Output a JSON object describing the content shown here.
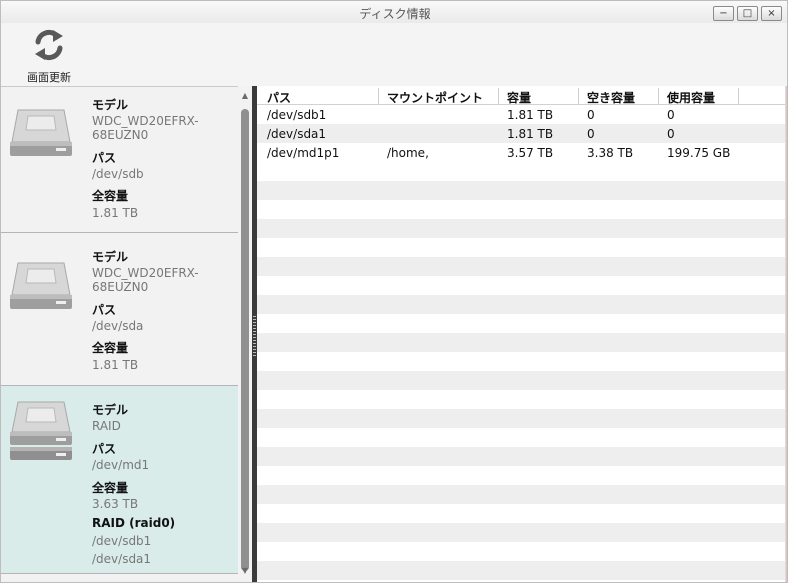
{
  "window": {
    "title": "ディスク情報",
    "buttons": {
      "minimize": "−",
      "maximize": "□",
      "close": "×"
    }
  },
  "toolbar": {
    "refresh_label": "画面更新",
    "refresh_icon": "refresh-icon"
  },
  "disks": [
    {
      "icon": "hard-drive-icon",
      "model_label": "モデル",
      "model_line1": "WDC_WD20EFRX-",
      "model_line2": "68EUZN0",
      "path_label": "パス",
      "path": "/dev/sdb",
      "capacity_label": "全容量",
      "capacity": "1.81 TB"
    },
    {
      "icon": "hard-drive-icon",
      "model_label": "モデル",
      "model_line1": "WDC_WD20EFRX-",
      "model_line2": "68EUZN0",
      "path_label": "パス",
      "path": "/dev/sda",
      "capacity_label": "全容量",
      "capacity": "1.81 TB"
    },
    {
      "icon": "raid-drive-icon",
      "model_label": "モデル",
      "model": "RAID",
      "path_label": "パス",
      "path": "/dev/md1",
      "capacity_label": "全容量",
      "capacity": "3.63 TB",
      "raid_label": "RAID (raid0)",
      "members": [
        "/dev/sdb1",
        "/dev/sda1"
      ]
    }
  ],
  "table": {
    "columns": [
      "パス",
      "マウントポイント",
      "容量",
      "空き容量",
      "使用容量"
    ],
    "rows": [
      [
        "/dev/sdb1",
        "",
        "1.81 TB",
        "0",
        "0"
      ],
      [
        "/dev/sda1",
        "",
        "1.81 TB",
        "0",
        "0"
      ],
      [
        "/dev/md1p1",
        "/home,",
        "3.57 TB",
        "3.38 TB",
        "199.75 GB"
      ]
    ]
  },
  "colors": {
    "selected_card": "#d9ecea",
    "splitter": "#3b3b3b",
    "zebra": "#eeeeee"
  }
}
